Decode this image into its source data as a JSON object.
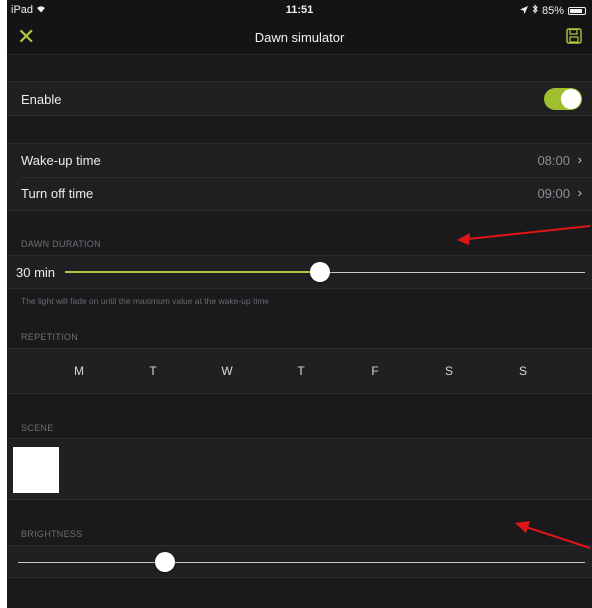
{
  "status_bar": {
    "device": "iPad",
    "time": "11:51",
    "battery": "85%",
    "battery_level": 0.85
  },
  "nav": {
    "title": "Dawn simulator",
    "close_icon": "close-x-icon",
    "save_icon": "save-disk-icon"
  },
  "enable": {
    "label": "Enable",
    "on": true
  },
  "times": {
    "wakeup_label": "Wake-up time",
    "wakeup_value": "08:00",
    "turnoff_label": "Turn off time",
    "turnoff_value": "09:00",
    "chevron": "›"
  },
  "dawn_duration": {
    "header": "DAWN DURATION",
    "value_label": "30 min",
    "level": 0.49,
    "footnote": "The light will fade on until the maximum value at the wake-up time"
  },
  "repetition": {
    "header": "REPETITION",
    "days": [
      "M",
      "T",
      "W",
      "T",
      "F",
      "S",
      "S"
    ]
  },
  "scene": {
    "header": "SCENE"
  },
  "brightness": {
    "header": "BRIGHTNESS",
    "level": 0.26
  },
  "colors": {
    "accent": "#b5c640",
    "toggle_on": "#9fbf2e",
    "background": "#1a1a1c",
    "row": "#202023",
    "annotation_arrow": "#e01515"
  }
}
